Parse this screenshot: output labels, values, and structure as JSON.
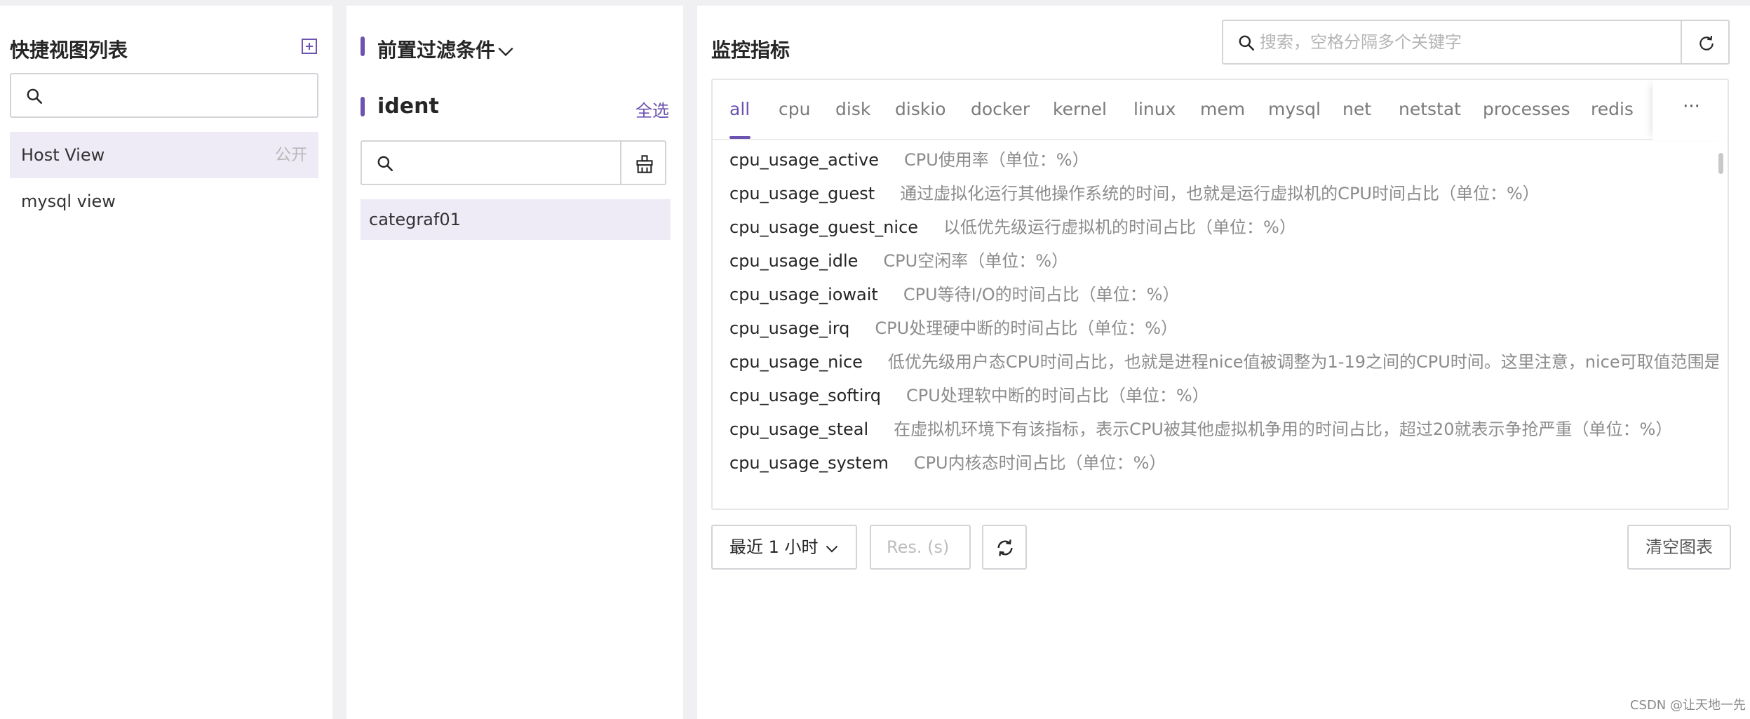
{
  "sidebar": {
    "title": "快捷视图列表",
    "add_icon": "plus-square-icon",
    "search": {
      "value": "",
      "placeholder": ""
    },
    "views": [
      {
        "label": "Host View",
        "tag": "公开"
      },
      {
        "label": "mysql view",
        "tag": ""
      }
    ]
  },
  "filters": {
    "title": "前置过滤条件",
    "ident_label": "ident",
    "select_all": "全选",
    "search": {
      "value": "",
      "placeholder": ""
    },
    "items": [
      "categraf01"
    ]
  },
  "metrics": {
    "title": "监控指标",
    "search": {
      "value": "",
      "placeholder": "搜索，空格分隔多个关键字"
    },
    "tabs": [
      "all",
      "cpu",
      "disk",
      "diskio",
      "docker",
      "kernel",
      "linux",
      "mem",
      "mysql",
      "net",
      "netstat",
      "processes",
      "redis"
    ],
    "active_tab": "all",
    "more_label": "···",
    "list": [
      {
        "name": "cpu_usage_active",
        "desc": "CPU使用率（单位：%）"
      },
      {
        "name": "cpu_usage_guest",
        "desc": "通过虚拟化运行其他操作系统的时间，也就是运行虚拟机的CPU时间占比（单位：%）"
      },
      {
        "name": "cpu_usage_guest_nice",
        "desc": "以低优先级运行虚拟机的时间占比（单位：%）"
      },
      {
        "name": "cpu_usage_idle",
        "desc": "CPU空闲率（单位：%）"
      },
      {
        "name": "cpu_usage_iowait",
        "desc": "CPU等待I/O的时间占比（单位：%）"
      },
      {
        "name": "cpu_usage_irq",
        "desc": "CPU处理硬中断的时间占比（单位：%）"
      },
      {
        "name": "cpu_usage_nice",
        "desc": "低优先级用户态CPU时间占比，也就是进程nice值被调整为1-19之间的CPU时间。这里注意，nice可取值范围是"
      },
      {
        "name": "cpu_usage_softirq",
        "desc": "CPU处理软中断的时间占比（单位：%）"
      },
      {
        "name": "cpu_usage_steal",
        "desc": "在虚拟机环境下有该指标，表示CPU被其他虚拟机争用的时间占比，超过20就表示争抢严重（单位：%）"
      },
      {
        "name": "cpu_usage_system",
        "desc": "CPU内核态时间占比（单位：%）"
      }
    ]
  },
  "toolbar": {
    "time_range": "最近 1 小时",
    "res_placeholder": "Res. (s)",
    "clear_label": "清空图表"
  },
  "watermark": "CSDN @让天地一先",
  "colors": {
    "accent": "#6c53b1",
    "selected_bg": "#eeebf6"
  }
}
